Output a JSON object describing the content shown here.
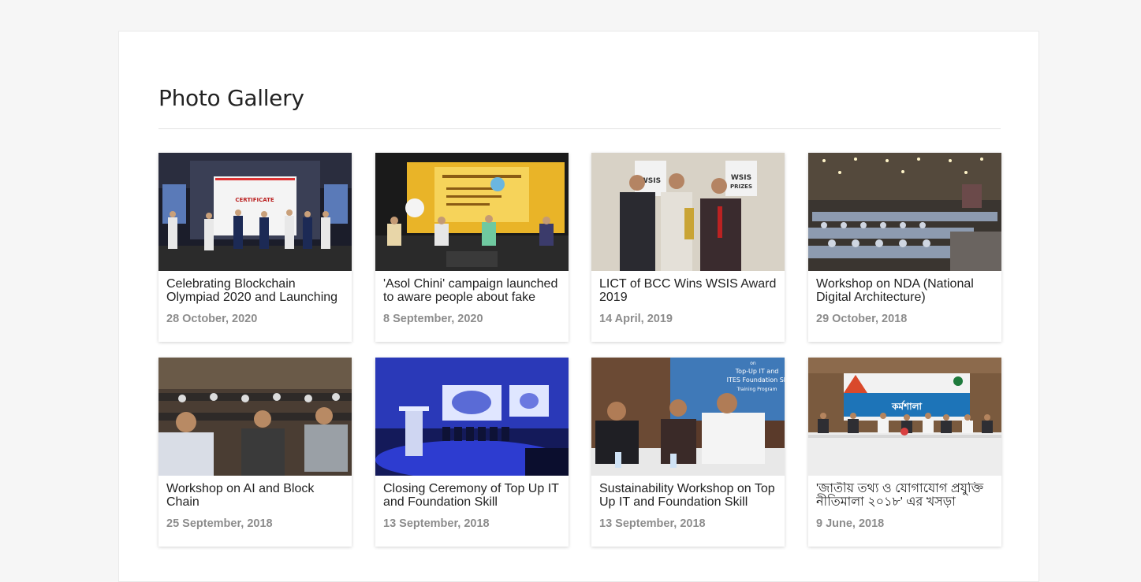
{
  "gallery": {
    "title": "Photo Gallery",
    "items": [
      {
        "caption": "Celebrating Blockchain Olympiad 2020 and Launching",
        "date": "28 October, 2020",
        "photo": "stage-certificate-photo"
      },
      {
        "caption": "'Asol Chini' campaign launched to aware people about fake",
        "date": "8 September, 2020",
        "photo": "yellow-stage-panel-photo"
      },
      {
        "caption": "LICT of BCC Wins WSIS Award 2019",
        "date": "14 April, 2019",
        "photo": "award-ceremony-photo"
      },
      {
        "caption": "Workshop on NDA (National Digital Architecture)",
        "date": "29 October, 2018",
        "photo": "conference-hall-photo"
      },
      {
        "caption": "Workshop on AI and Block Chain",
        "date": "25 September, 2018",
        "photo": "audience-seated-photo"
      },
      {
        "caption": "Closing Ceremony of Top Up IT and Foundation Skill",
        "date": "13 September, 2018",
        "photo": "blue-stage-podium-photo"
      },
      {
        "caption": "Sustainability Workshop on Top Up IT and Foundation Skill",
        "date": "13 September, 2018",
        "photo": "speakers-table-photo"
      },
      {
        "caption": "'জাতীয় তথ্য ও যোগাযোগ প্রযুক্তি নীতিমালা ২০১৮' এর খসড়া",
        "date": "9 June, 2018",
        "photo": "workshop-banner-photo"
      }
    ],
    "photo_texts": {
      "certificate": "CERTIFICATE",
      "wsis": "WSIS",
      "prizes": "PRIZES",
      "top_up_line1": "Top-Up IT and",
      "top_up_line2": "ITES Foundation Sk",
      "top_up_line3": "Training Program",
      "top_up_on": "on",
      "banner_word": "কর্মশালা"
    }
  }
}
